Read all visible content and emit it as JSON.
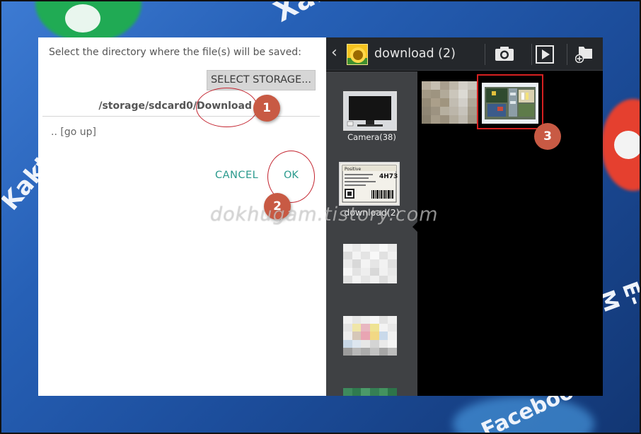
{
  "dialog": {
    "prompt": "Select the directory where the file(s) will be saved:",
    "select_storage_label": "SELECT STORAGE...",
    "path": "/storage/sdcard0/Download",
    "go_up": ".. [go up]",
    "cancel_label": "CANCEL",
    "ok_label": "OK"
  },
  "gallery": {
    "title": "download (2)",
    "albums": [
      {
        "label": "Camera(38)"
      },
      {
        "label": "download(2)"
      },
      {
        "label": ""
      },
      {
        "label": ""
      },
      {
        "label": ""
      }
    ],
    "download_thumb_text": {
      "brand": "Positive",
      "code": "4H73"
    }
  },
  "annotations": {
    "badge1": "1",
    "badge2": "2",
    "badge3": "3",
    "highlight_color": "#d62020",
    "badge_color": "#c85a44"
  },
  "watermark": "dokhugam.tistory.com",
  "background": {
    "text1": "Xab",
    "text2": "Kakte",
    "text3": "E-M",
    "text4": "Facebook"
  },
  "colors": {
    "dialog_button_text": "#2a9a8d",
    "toolbar_bg": "#24272b",
    "album_strip_bg": "#3f4144"
  }
}
